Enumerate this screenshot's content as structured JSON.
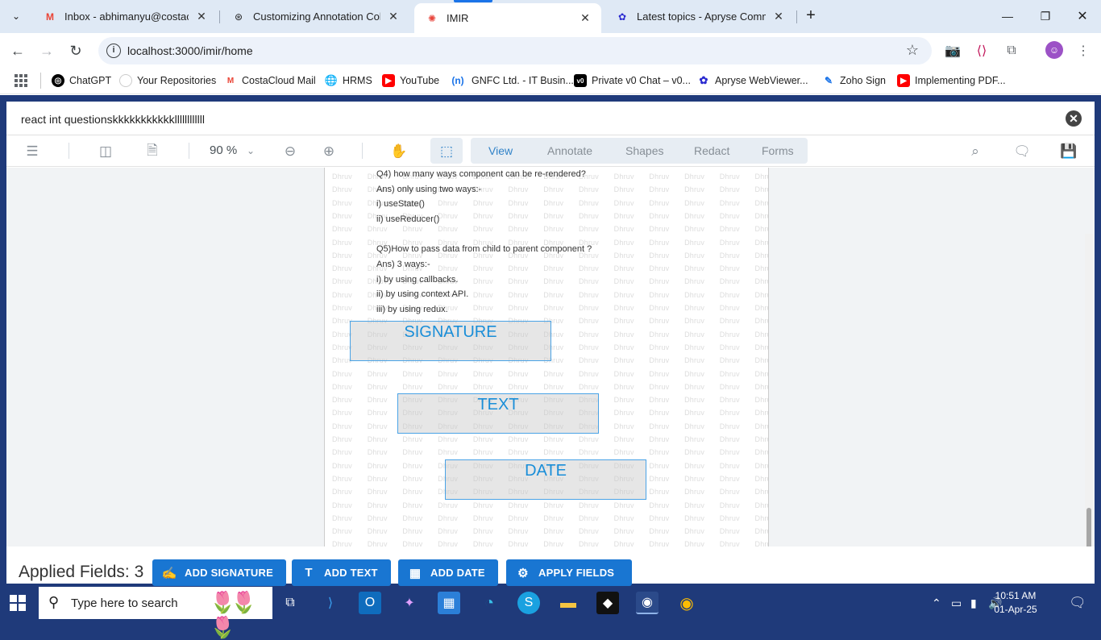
{
  "browser": {
    "tabs": [
      {
        "title": "Inbox - abhimanyu@costacloud",
        "icon": "gmail-icon",
        "active": false
      },
      {
        "title": "Customizing Annotation Colors",
        "icon": "openai-icon",
        "active": false
      },
      {
        "title": "IMIR",
        "icon": "imir-icon",
        "active": true
      },
      {
        "title": "Latest topics - Apryse Commun",
        "icon": "apryse-icon",
        "active": false
      }
    ],
    "url": "localhost:3000/imir/home",
    "bookmarks": [
      {
        "label": "ChatGPT",
        "icon": "openai-icon",
        "color": "#000000"
      },
      {
        "label": "Your Repositories",
        "icon": "github-icon",
        "color": "#ffffff"
      },
      {
        "label": "CostaCloud Mail",
        "icon": "gmail-icon",
        "color": "#ea4335"
      },
      {
        "label": "HRMS",
        "icon": "globe-icon",
        "color": "#3c4043"
      },
      {
        "label": "YouTube",
        "icon": "youtube-icon",
        "color": "#ff0000"
      },
      {
        "label": "GNFC Ltd. - IT Busin...",
        "icon": "gnfc-icon",
        "color": "#1a73e8"
      },
      {
        "label": "Private v0 Chat – v0...",
        "icon": "v0-icon",
        "color": "#000000"
      },
      {
        "label": "Apryse WebViewer...",
        "icon": "apryse-icon",
        "color": "#2a2ad0"
      },
      {
        "label": "Zoho Sign",
        "icon": "zoho-icon",
        "color": "#1a73e8"
      },
      {
        "label": "Implementing PDF...",
        "icon": "youtube-icon",
        "color": "#ff0000"
      }
    ]
  },
  "modal": {
    "title": "react int questionskkkkkkkkkkkllllllllllll"
  },
  "viewer": {
    "zoom": "90 %",
    "tabs": [
      "View",
      "Annotate",
      "Shapes",
      "Redact",
      "Forms"
    ],
    "active_tab": "View"
  },
  "document": {
    "lines": [
      "Q4) how many ways component can be re-rendered?",
      "Ans) only using two ways:-",
      "i) useState()",
      "ii) useReducer()",
      "",
      "Q5)How to pass data from child to parent component ?",
      "Ans) 3 ways:-",
      "i) by using callbacks.",
      "ii) by using context API.",
      "iii) by using redux."
    ],
    "watermark_word": "Dhruv",
    "fields": [
      {
        "label": "SIGNATURE"
      },
      {
        "label": "TEXT"
      },
      {
        "label": "DATE"
      }
    ]
  },
  "bottom": {
    "applied_label": "Applied Fields: 3",
    "buttons": [
      {
        "label": "ADD SIGNATURE",
        "icon": "signature-icon"
      },
      {
        "label": "ADD TEXT",
        "icon": "text-icon"
      },
      {
        "label": "ADD DATE",
        "icon": "calendar-icon"
      },
      {
        "label": "APPLY FIELDS",
        "icon": "gear-icon"
      }
    ],
    "accent": "#1976d2"
  },
  "taskbar": {
    "search_placeholder": "Type here to search",
    "time": "10:51 AM",
    "date": "01-Apr-25"
  }
}
